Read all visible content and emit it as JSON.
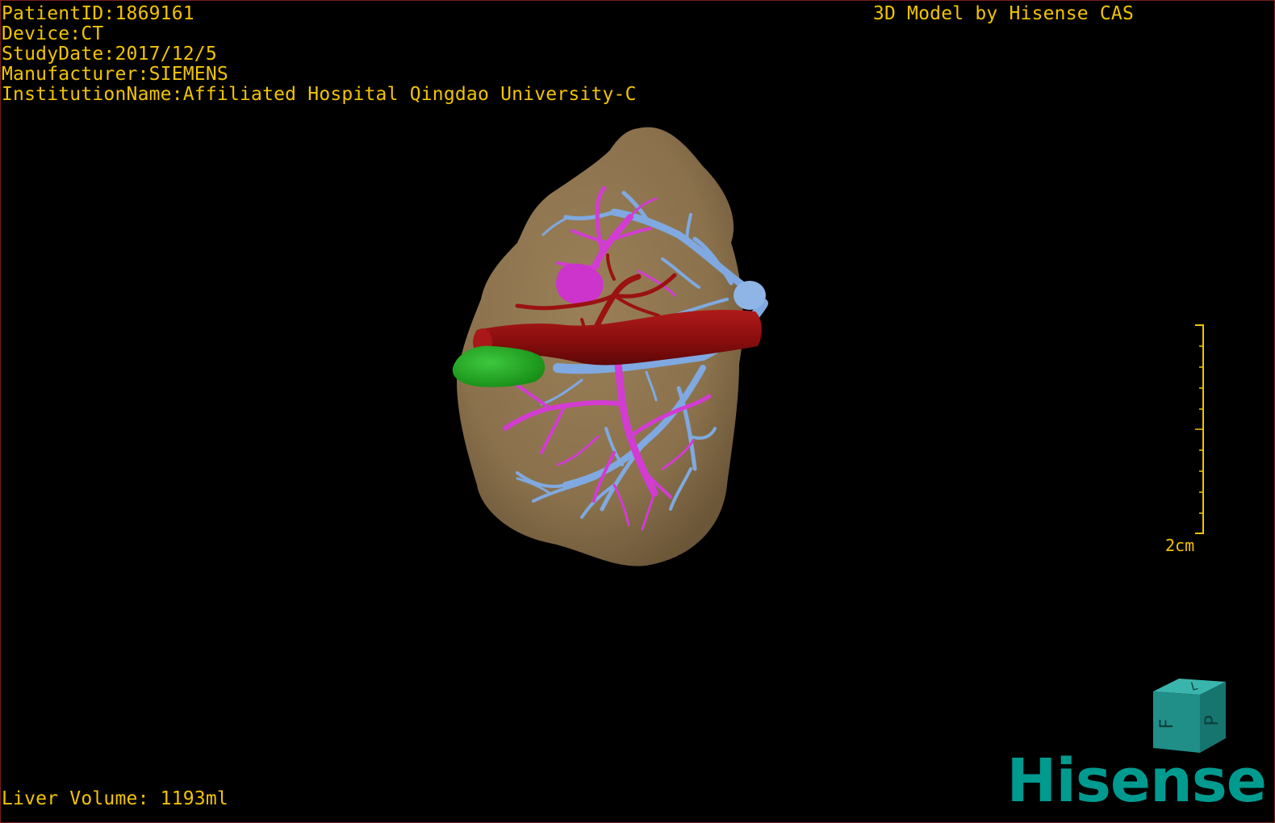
{
  "viewer": {
    "patient_id": "PatientID:1869161",
    "device": "Device:CT",
    "study_date": "StudyDate:2017/12/5",
    "manufacturer": "Manufacturer:SIEMENS",
    "institution": "InstitutionName:Affiliated Hospital Qingdao University-C",
    "credit": "3D Model by Hisense CAS",
    "liver_volume": "Liver Volume: 1193ml",
    "scale_label": "2cm",
    "logo_text": "Hisense",
    "cube_faces": {
      "front": "F",
      "side": "P",
      "top": "L"
    }
  },
  "colors": {
    "overlay_text": "#f2c400",
    "liver": "#8e7550",
    "artery": "#8e0f0f",
    "portal_vein": "#d23cd2",
    "hepatic_vein": "#7fa9e0",
    "gallbladder": "#22a522",
    "brand": "#009a8f"
  }
}
